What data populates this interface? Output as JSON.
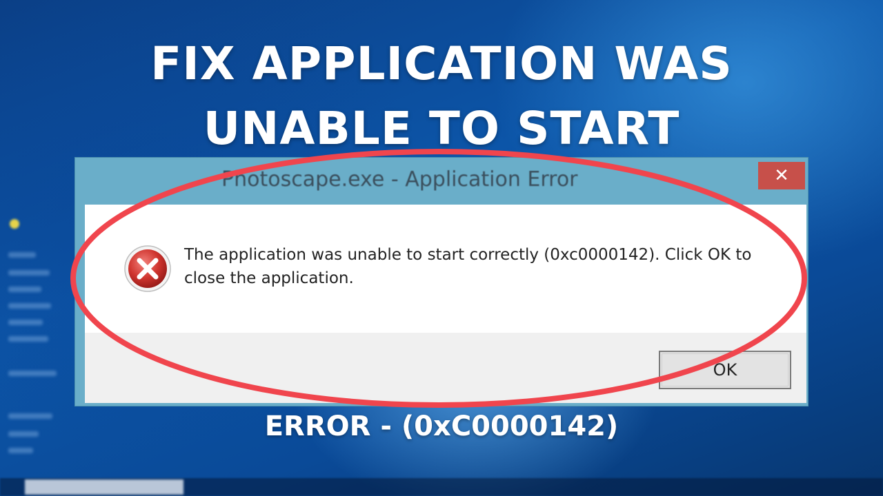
{
  "headline": {
    "line1": "FIX APPLICATION WAS",
    "line2": "UNABLE TO START"
  },
  "dialog": {
    "title": "Photoscape.exe - Application Error",
    "close_glyph": "✕",
    "message": "The application was unable to start correctly (0xc0000142). Click OK to close the application.",
    "icon": "error-icon",
    "ok_label": "OK"
  },
  "caption": "ERROR - (0xC0000142)",
  "colors": {
    "annotation_ellipse": "#f0454d",
    "titlebar": "#6aaec9",
    "close_button": "#c7504a",
    "error_icon": "#c9302c"
  }
}
